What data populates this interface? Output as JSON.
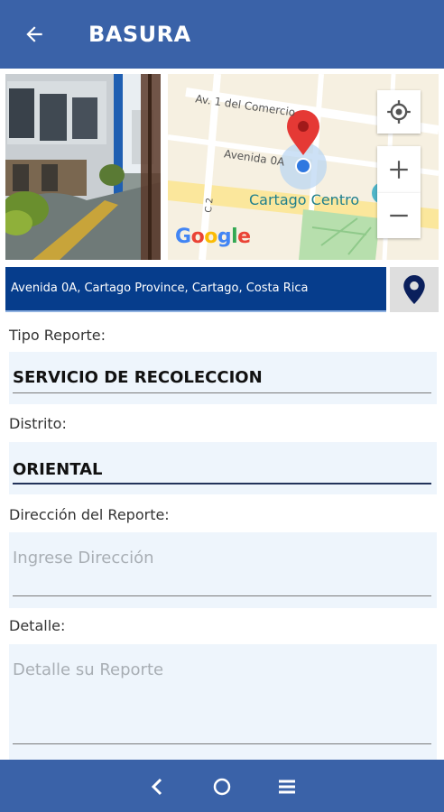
{
  "header": {
    "title": "BASURA"
  },
  "map": {
    "street1": "Av. 1 del Comercio",
    "street2": "Avenida 0A",
    "street3": "C 2",
    "place": "Cartago Centro",
    "google_logo": "Google"
  },
  "address": {
    "text": "Avenida 0A, Cartago Province, Cartago, Costa Rica"
  },
  "form": {
    "tipo_label": "Tipo Reporte:",
    "tipo_value": "SERVICIO DE RECOLECCION",
    "distrito_label": "Distrito:",
    "distrito_value": "ORIENTAL",
    "direccion_label": "Dirección del Reporte:",
    "direccion_placeholder": "Ingrese Dirección",
    "detalle_label": "Detalle:",
    "detalle_placeholder": "Detalle su Reporte"
  },
  "colors": {
    "appbar": "#3a62a8",
    "address_bg": "#063d8c",
    "field_bg": "#eef5fc",
    "pin_red": "#e53935",
    "pin_navy": "#0a1f5c"
  },
  "icons": {
    "back": "arrow-left-icon",
    "pin": "location-pin-icon",
    "my_location": "my-location-icon",
    "zoom_in": "plus-icon",
    "zoom_out": "minus-icon",
    "nav_back": "chevron-left-icon",
    "nav_home": "circle-icon",
    "nav_menu": "menu-icon"
  }
}
